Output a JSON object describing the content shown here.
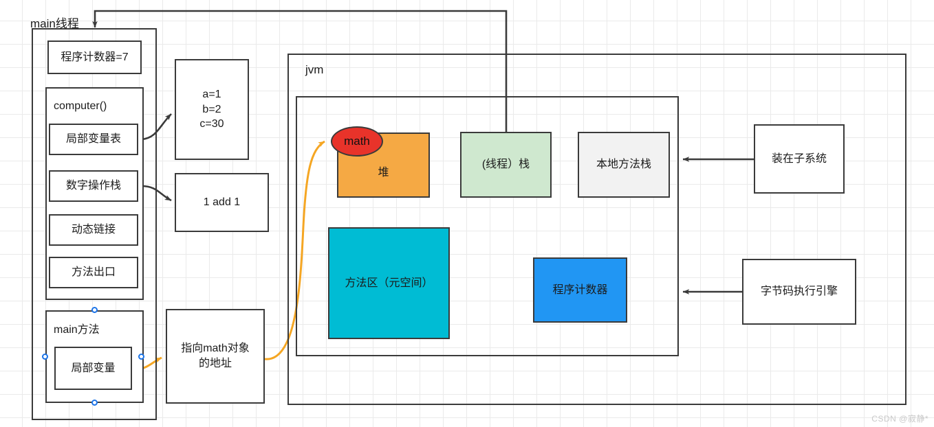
{
  "diagram": {
    "title_main_thread": "main线程",
    "title_jvm": "jvm",
    "watermark": "CSDN @寂静*"
  },
  "colors": {
    "stroke": "#3a3a3a",
    "heap_fill": "#F5A944",
    "math_fill": "#E8332A",
    "stack_fill": "#CFE8CF",
    "native_fill": "#F2F2F2",
    "method_area_fill": "#00BCD4",
    "pc_fill": "#2196F3",
    "orange_arrow": "#F5A623",
    "handle": "#1a73e8",
    "grid": "#eaeaea"
  },
  "main_thread": {
    "program_counter": "程序计数器=7",
    "frame_computer": {
      "title": "computer()",
      "slots": [
        "局部变量表",
        "数字操作栈",
        "动态链接",
        "方法出口"
      ]
    },
    "frame_main": {
      "title": "main方法",
      "slot": "局部变量"
    }
  },
  "detail_boxes": {
    "local_vars": "a=1\nb=2\nc=30",
    "operand_stack": "1  add  1",
    "reference": "指向math对象\n的地址"
  },
  "jvm": {
    "heap_label": "堆",
    "heap_object": "math",
    "thread_stack": "(线程）栈",
    "native_method_stack": "本地方法栈",
    "method_area": "方法区（元空间）",
    "program_counter": "程序计数器"
  },
  "external": {
    "class_loader": "装在子系统",
    "execution_engine": "字节码执行引擎"
  }
}
